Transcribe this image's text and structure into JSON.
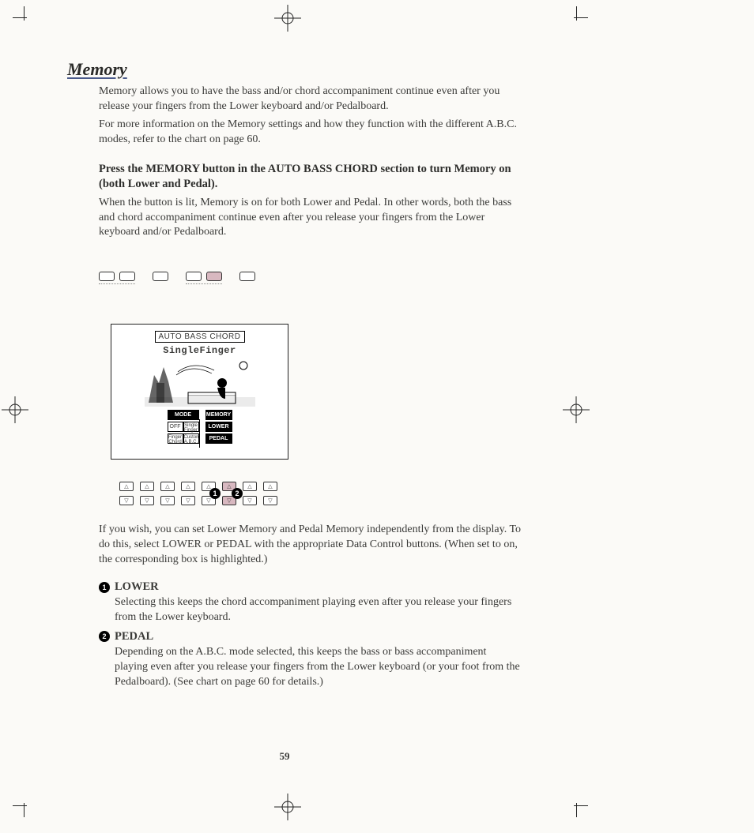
{
  "section_title": "Memory",
  "intro_p1": "Memory allows you to have the bass and/or chord accompaniment continue even after you release your fingers from the Lower keyboard and/or Pedalboard.",
  "intro_p2": "For more information on the Memory settings and how they function with the different A.B.C. modes, refer to the chart on page 60.",
  "bold_instruction": "Press the MEMORY button in the AUTO BASS CHORD section to turn Memory on (both Lower and Pedal).",
  "after_bold": "When the button is lit, Memory is on for both Lower and Pedal.  In other words, both the bass and chord accompaniment continue even after you release your fingers from the Lower keyboard and/or Pedalboard.",
  "lcd": {
    "title": "AUTO BASS CHORD",
    "mode": "SingleFinger",
    "left_col": {
      "header": "MODE",
      "cells": [
        "OFF",
        "Single Finger",
        "Finger Chord",
        "Custom A.B.C."
      ]
    },
    "right_col": {
      "header": "MEMORY",
      "cells": [
        "LOWER",
        "PEDAL"
      ]
    }
  },
  "callout_1": "1",
  "callout_2": "2",
  "post_lcd": "If you wish, you can set Lower Memory and Pedal Memory independently from the display.  To do this, select LOWER or PEDAL with the appropriate Data Control buttons.  (When set to on, the corresponding box is highlighted.)",
  "item1_title": "LOWER",
  "item1_body": "Selecting this keeps the chord accompaniment playing even after you release your fingers from the Lower keyboard.",
  "item2_title": "PEDAL",
  "item2_body": "Depending on the A.B.C. mode selected, this keeps the bass or bass accompaniment playing even after you release your fingers from the Lower keyboard (or your foot from the Pedalboard).  (See chart on page 60 for details.)",
  "page_number": "59"
}
